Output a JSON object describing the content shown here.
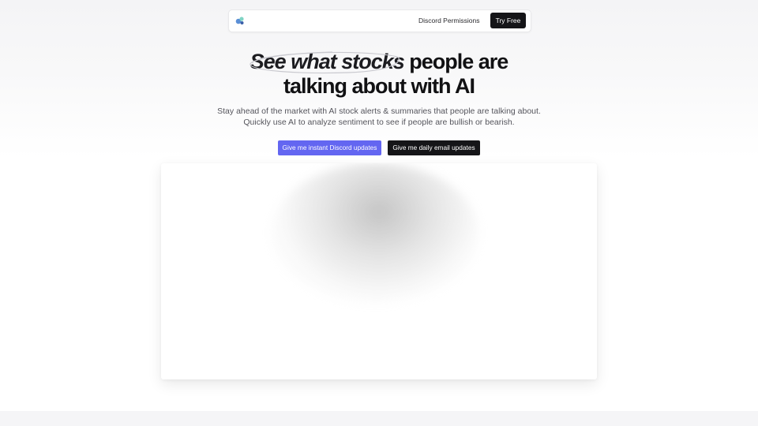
{
  "nav": {
    "logo_icon": "app-logo-icon",
    "permissions_label": "Discord Permissions",
    "try_free_label": "Try Free"
  },
  "hero": {
    "title_emphasis": "See what stocks",
    "title_rest_line1": "people are",
    "title_line2": "talking about with AI",
    "subtitle_line1": "Stay ahead of the market with AI stock alerts & summaries that people are talking about.",
    "subtitle_line2": "Quickly use AI to analyze sentiment to see if people are bullish or bearish."
  },
  "cta": {
    "discord_label": "Give me instant Discord updates",
    "email_label": "Give me daily email updates"
  },
  "colors": {
    "accent": "#6366f1",
    "dark_button": "#151518",
    "subtitle_text": "#55555c"
  }
}
